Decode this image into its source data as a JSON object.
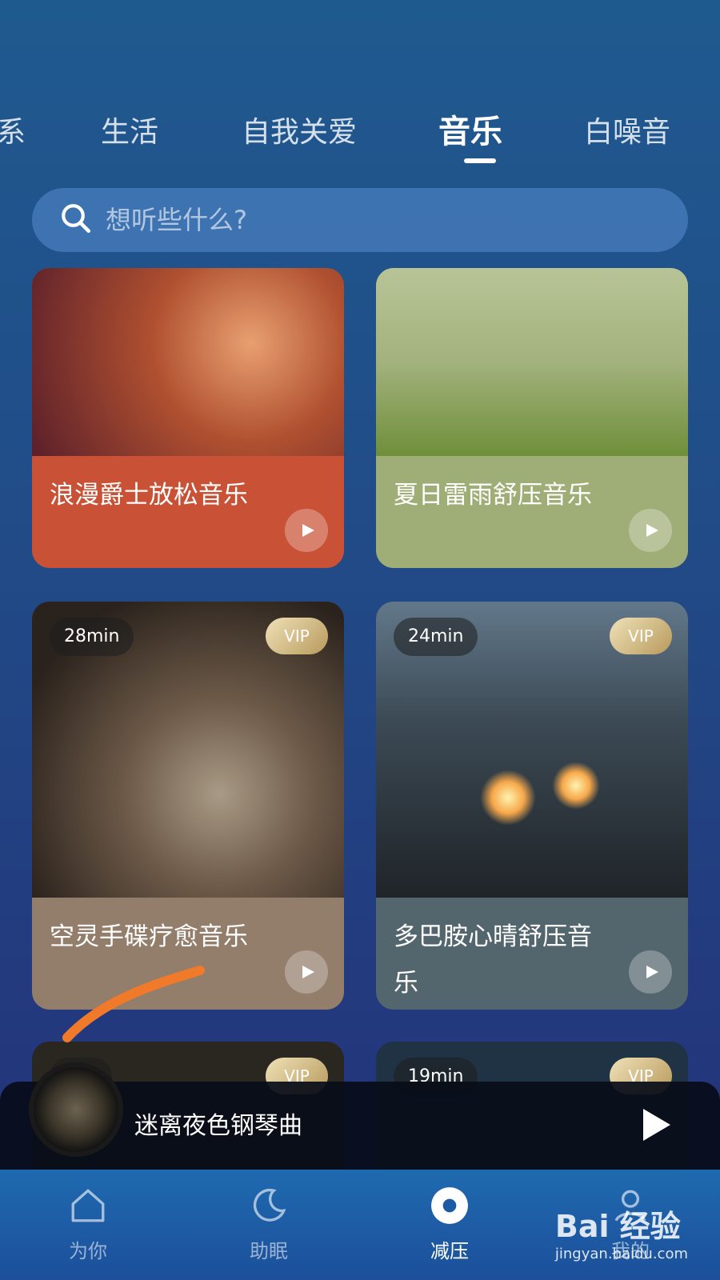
{
  "tabs": [
    {
      "label": "系"
    },
    {
      "label": "生活"
    },
    {
      "label": "自我关爱"
    },
    {
      "label": "音乐",
      "active": true
    },
    {
      "label": "白噪音"
    }
  ],
  "search": {
    "placeholder": "想听些什么?"
  },
  "cards": [
    {
      "title": "浪漫爵士放松音乐"
    },
    {
      "title": "夏日雷雨舒压音乐"
    },
    {
      "title": "空灵手碟疗愈音乐",
      "duration": "28min",
      "badge": "VIP"
    },
    {
      "title": "多巴胺心晴舒压音乐",
      "duration": "24min",
      "badge": "VIP"
    },
    {
      "duration": "min",
      "badge": "VIP"
    },
    {
      "duration": "19min",
      "badge": "VIP"
    }
  ],
  "player": {
    "title": "迷离夜色钢琴曲"
  },
  "nav": [
    {
      "label": "为你"
    },
    {
      "label": "助眠"
    },
    {
      "label": "减压",
      "active": true
    },
    {
      "label": "我的"
    }
  ],
  "watermark": {
    "brand": "Bai 经验",
    "url": "jingyan.baidu.com"
  },
  "colors": {
    "accent": "#ffffff",
    "annotation_stroke": "#f07a2a",
    "nav_bg": "#1c5aa6"
  }
}
